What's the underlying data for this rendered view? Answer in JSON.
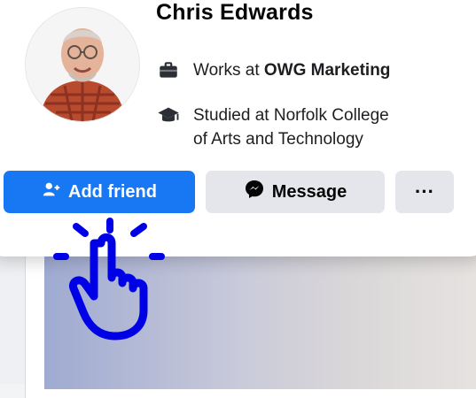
{
  "profile": {
    "name": "Chris Edwards",
    "work_prefix": "Works at ",
    "work_place": "OWG Marketing",
    "education_prefix": "Studied at ",
    "education_place_line1": "Norfolk College",
    "education_place_line2": "of Arts and Technology"
  },
  "actions": {
    "add_friend_label": "Add friend",
    "message_label": "Message",
    "more_label": "···"
  },
  "icons": {
    "work": "briefcase-icon",
    "education": "graduation-cap-icon",
    "add_friend": "add-person-icon",
    "message": "messenger-icon",
    "hand": "pointing-hand-icon"
  },
  "colors": {
    "primary_blue": "#1877F2",
    "secondary_button": "#E4E6EB",
    "overlay_hand": "#0000E6"
  }
}
